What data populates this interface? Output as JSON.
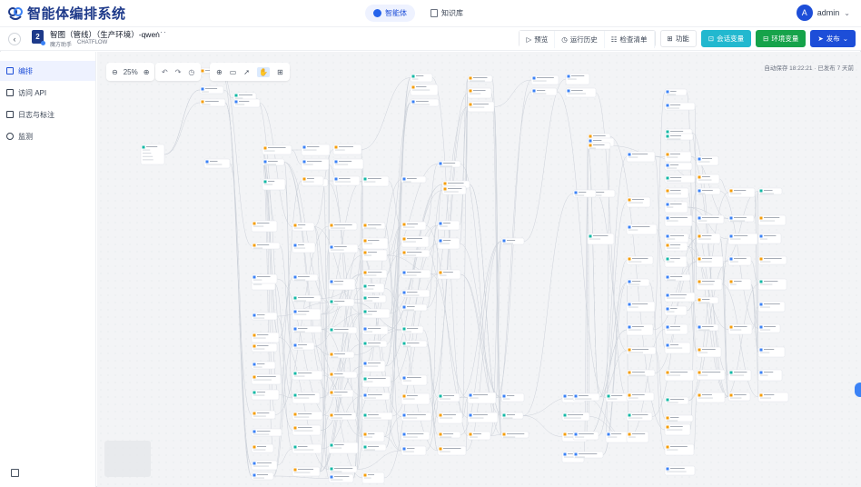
{
  "app": {
    "logo_text": "智能体编排系统",
    "colors": {
      "primary": "#1d4ed8",
      "teal": "#22b8cf",
      "green": "#16a34a",
      "node_blue": "#3b82f6",
      "node_orange": "#f59e0b",
      "node_teal": "#14b8a6"
    }
  },
  "nav": {
    "tabs": [
      {
        "label": "智能体",
        "icon": "bot-icon"
      },
      {
        "label": "知识库",
        "icon": "book-icon"
      }
    ]
  },
  "user": {
    "avatar_letter": "A",
    "name": "admin"
  },
  "header": {
    "app_number": "2",
    "title": "智图（管线）（生产环境）-qwen",
    "more": "···",
    "tag_owner": "魔方助手",
    "tag_type": "CHATFLOW",
    "buttons": {
      "preview": "预览",
      "history": "运行历史",
      "checklist": "检查清单",
      "features": "功能",
      "conversation_vars": "会话变量",
      "env_vars": "环境变量",
      "publish": "发布"
    }
  },
  "sidebar": {
    "items": [
      {
        "label": "编排",
        "active": true
      },
      {
        "label": "访问 API",
        "active": false
      },
      {
        "label": "日志与标注",
        "active": false
      },
      {
        "label": "监测",
        "active": false
      }
    ]
  },
  "canvas": {
    "zoom_label": "25%",
    "autosave": "自动保存 18:22:21 · 已发布 7 天前"
  }
}
